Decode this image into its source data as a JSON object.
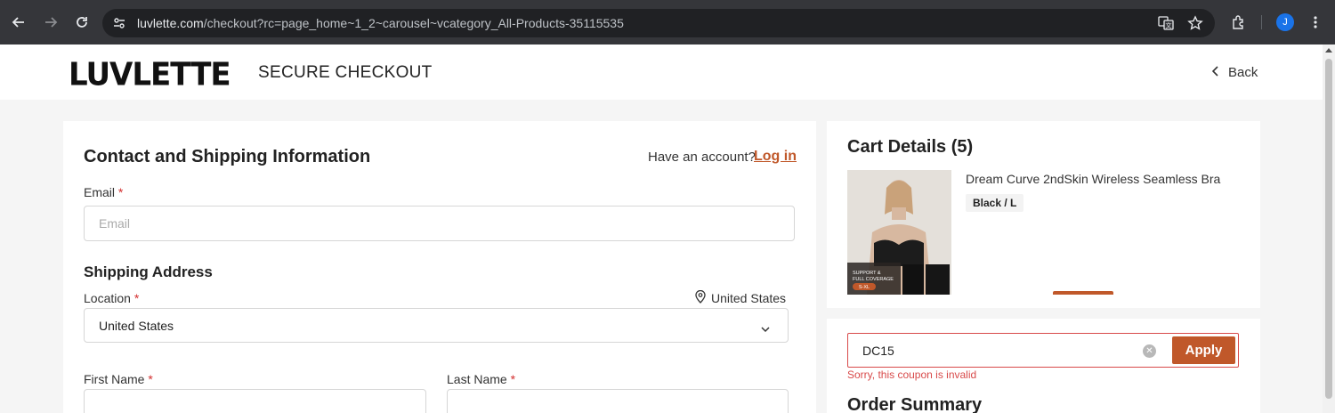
{
  "browser": {
    "url_host": "luvlette.com",
    "url_path": "/checkout?rc=page_home~1_2~carousel~vcategory_All-Products-35115535",
    "profile_initial": "J"
  },
  "header": {
    "logo": "LUVLETTE",
    "title": "SECURE CHECKOUT",
    "back_label": "Back"
  },
  "contact": {
    "title": "Contact and Shipping Information",
    "have_account": "Have an account?",
    "login_label": "Log in",
    "email_label": "Email",
    "required_mark": "*",
    "email_placeholder": "Email"
  },
  "shipping": {
    "title": "Shipping Address",
    "location_label": "Location",
    "location_hint": "United States",
    "location_value": "United States",
    "first_name_label": "First Name",
    "last_name_label": "Last Name"
  },
  "cart": {
    "title": "Cart Details (5)",
    "items": [
      {
        "name": "Dream Curve 2ndSkin Wireless Seamless Bra",
        "variant": "Black / L",
        "image_badge_1": "SUPPORT &",
        "image_badge_2": "FULL COVERAGE",
        "image_badge_size": "S-XL"
      }
    ]
  },
  "coupon": {
    "value": "DC15",
    "apply_label": "Apply",
    "error": "Sorry, this coupon is invalid"
  },
  "summary": {
    "title": "Order Summary"
  },
  "colors": {
    "accent": "#c0582a",
    "error": "#d84a4a",
    "chrome_bg": "#35363a"
  }
}
